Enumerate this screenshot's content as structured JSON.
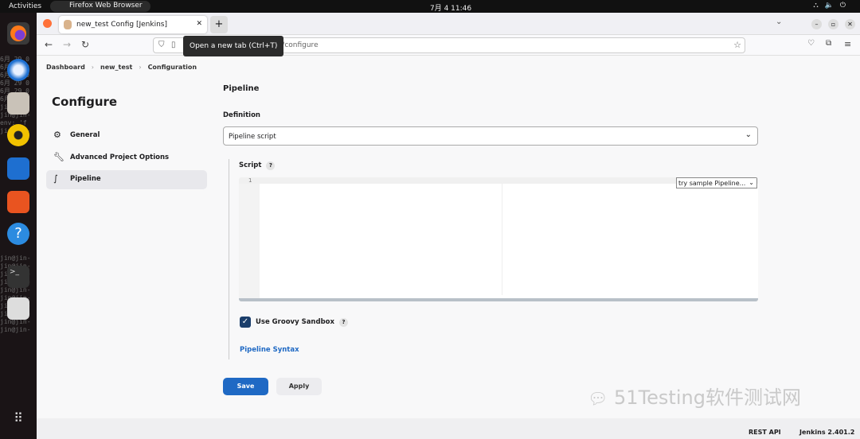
{
  "os": {
    "activities": "Activities",
    "app_name": "Firefox Web Browser",
    "clock": "7月 4  11:46",
    "tray_icons": [
      "network-icon",
      "volume-icon",
      "power-icon"
    ]
  },
  "dock": {
    "terminal_text": "6月 29 0\n6月 29 0\n6月 29 0\n6月 29 0\n6月 29 0\n6月 29 0\njin@jin-\njin@jin-\nenv: 'f\njin@jin-\n\n\n\n\n\n\n\n\n\n\n\n\n\n\n\njin@jin-\njin@jin-\njin@jin-\njin@jin-\njin@jin-\njin@jin-\njin@jin-\njin@jin-\njin@jin-\njin@jin-"
  },
  "browser": {
    "tab_title": "new_test Config [Jenkins]",
    "tooltip": "Open a new tab (Ctrl+T)",
    "url_visible": "test/configure"
  },
  "breadcrumb": [
    "Dashboard",
    "new_test",
    "Configuration"
  ],
  "sidebar": {
    "title": "Configure",
    "items": [
      {
        "label": "General",
        "icon": "gear-icon"
      },
      {
        "label": "Advanced Project Options",
        "icon": "wrench-icon"
      },
      {
        "label": "Pipeline",
        "icon": "pipeline-icon",
        "active": true
      }
    ]
  },
  "main": {
    "section": "Pipeline",
    "definition_label": "Definition",
    "definition_value": "Pipeline script",
    "script_label": "Script",
    "line_number": "1",
    "sample_select": "try sample Pipeline...",
    "sandbox_label": "Use Groovy Sandbox",
    "sandbox_checked": true,
    "syntax_link": "Pipeline Syntax",
    "save": "Save",
    "apply": "Apply"
  },
  "footer": {
    "rest_api": "REST API",
    "version": "Jenkins 2.401.2"
  },
  "watermark": "51Testing软件测试网",
  "colors": {
    "accent": "#1f69c4",
    "save_button": "#1f69c4",
    "checkbox": "#1b3e6b"
  }
}
